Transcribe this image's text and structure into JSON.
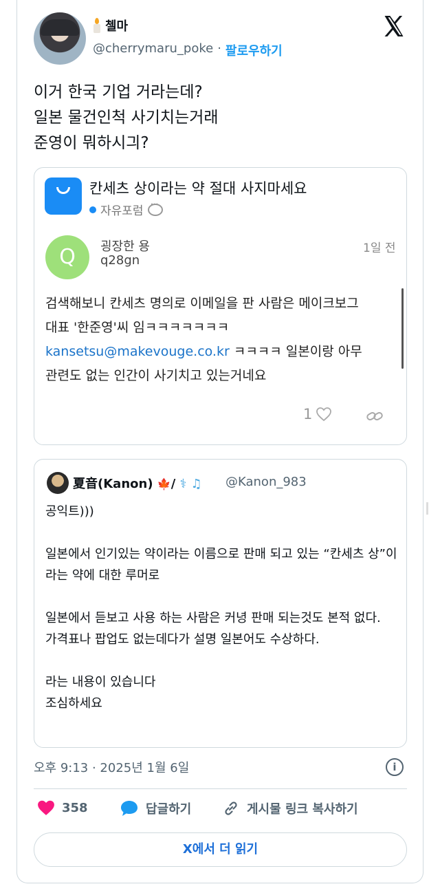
{
  "author": {
    "display_name": "첼마",
    "handle": "@cherrymaru_poke",
    "separator": "·",
    "follow_label": "팔로우하기"
  },
  "tweet_text": "이거 한국 기업 거라는데?\n일본 물건인척 사기치는거래\n준영이 뭐하시긔?",
  "quote_post": {
    "title": "칸세츠 상이라는 약 절대 사지마세요",
    "forum": "자유포럼",
    "avatar_letter": "Q",
    "user": "굉장한 용",
    "user_id": "q28gn",
    "time": "1일 전",
    "body_line1": "검색해보니 칸세츠 명의로 이메일을 판 사람은 메이크보그",
    "body_line2": "대표 '한준영'씨 임ㅋㅋㅋㅋㅋㅋㅋ",
    "email": "kansetsu@makevouge.co.kr",
    "body_line3_rest": " ㅋㅋㅋㅋ 일본이랑 아무",
    "body_line4": "관련도 없는 인간이 사기치고 있는거네요",
    "like_count": "1"
  },
  "quote_tweet": {
    "name": "夏音(Kanon)",
    "name_suffix": "/",
    "handle": "@Kanon_983",
    "body": "공익트)))\n\n일본에서 인기있는 약이라는 이름으로 판매 되고 있는 “칸세츠 상”이라는 약에 대한 루머로\n\n일본에서 듣보고 사용 하는 사람은 커녕 판매 되는것도 본적 없다.\n가격표나 팝업도 없는데다가 설명 일본어도 수상하다.\n\n라는 내용이 있습니다\n조심하세요"
  },
  "timestamp": "오후 9:13 · 2025년 1월 6일",
  "actions": {
    "like_count": "358",
    "reply_label": "답글하기",
    "copy_link_label": "게시물 링크 복사하기"
  },
  "read_more_label": "X에서 더 읽기",
  "colors": {
    "accent": "#1d9bf0",
    "heart": "#f91880",
    "bubble": "#1d9bf0"
  }
}
